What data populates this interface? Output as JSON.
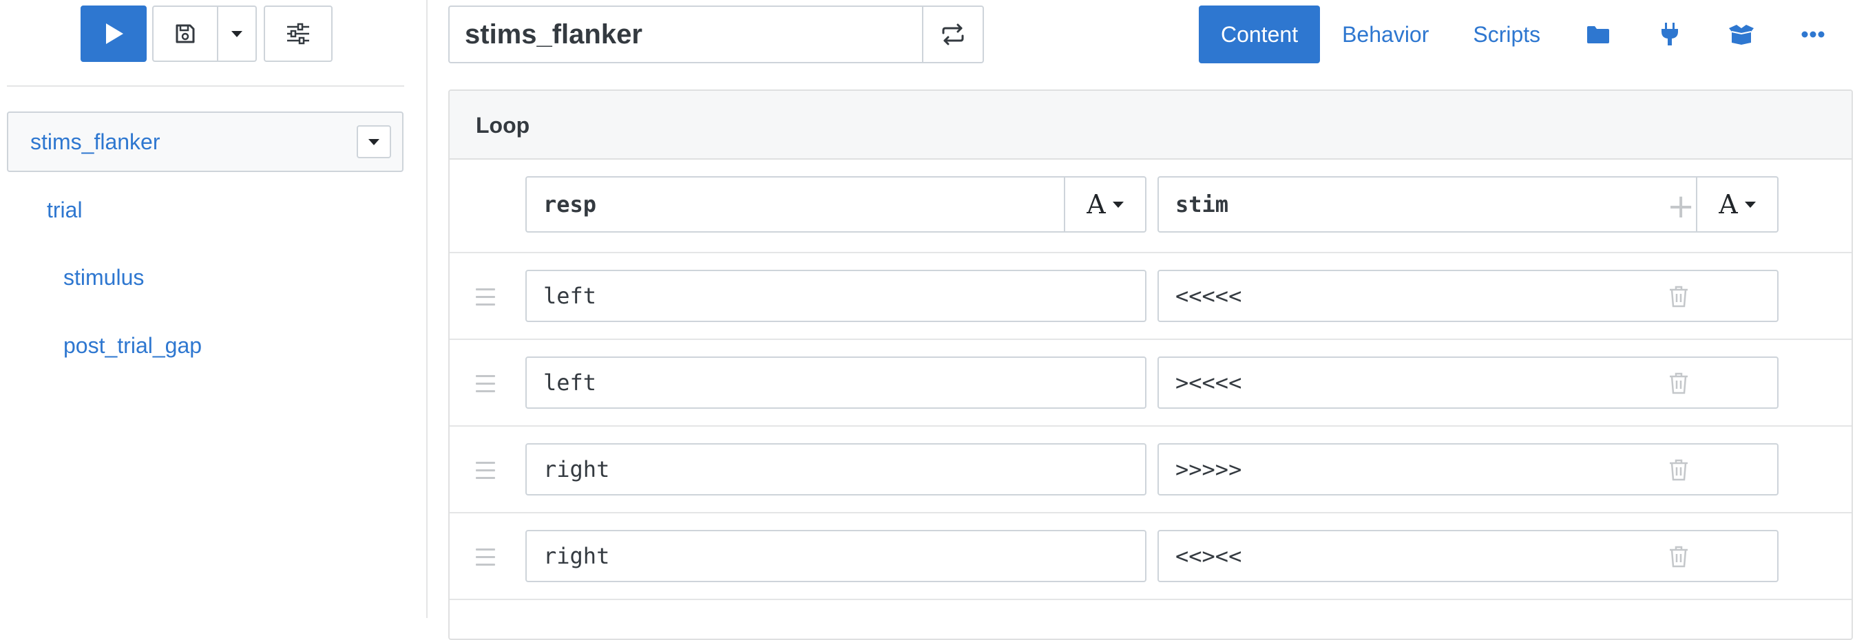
{
  "sidebar": {
    "root_label": "stims_flanker",
    "items": [
      {
        "label": "trial"
      },
      {
        "label": "stimulus"
      },
      {
        "label": "post_trial_gap"
      }
    ]
  },
  "header": {
    "title_value": "stims_flanker",
    "tabs": [
      {
        "label": "Content",
        "active": true
      },
      {
        "label": "Behavior",
        "active": false
      },
      {
        "label": "Scripts",
        "active": false
      }
    ],
    "icons": [
      "folder-icon",
      "plug-icon",
      "box-icon",
      "more-icon"
    ]
  },
  "loop": {
    "title": "Loop",
    "columns": [
      {
        "name": "resp",
        "type": "A"
      },
      {
        "name": "stim",
        "type": "A"
      }
    ],
    "rows": [
      {
        "resp": "left",
        "stim": "<<<<<"
      },
      {
        "resp": "left",
        "stim": "><<<<"
      },
      {
        "resp": "right",
        "stim": ">>>>>"
      },
      {
        "resp": "right",
        "stim": "<<><<"
      }
    ]
  },
  "colors": {
    "accent": "#2e77d0",
    "border": "#ced4da",
    "muted": "#c4c7ca"
  }
}
